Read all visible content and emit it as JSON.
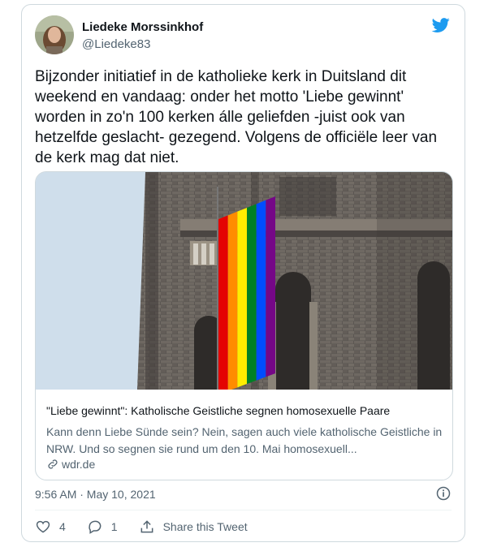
{
  "author": {
    "name": "Liedeke Morssinkhof",
    "handle": "@Liedeke83"
  },
  "tweet": {
    "text": "Bijzonder initiatief in de katholieke kerk in Duitsland dit weekend en vandaag: onder het motto 'Liebe gewinnt' worden in zo'n 100 kerken álle geliefden -juist ook van hetzelfde geslacht- gezegend. Volgens de officiële leer van de kerk mag dat niet.",
    "timestamp": "9:56 AM · May 10, 2021"
  },
  "link_card": {
    "title": "\"Liebe gewinnt\": Katholische Geistliche segnen homosexuelle Paare",
    "description": "Kann denn Liebe Sünde sein? Nein, sagen auch viele katholische Geistliche in NRW. Und so segnen sie rund um den 10. Mai homosexuell...",
    "domain": "wdr.de"
  },
  "actions": {
    "likes": "4",
    "replies": "1",
    "share_label": "Share this Tweet"
  },
  "colors": {
    "brand": "#1d9bf0",
    "secondary_text": "#536471",
    "border": "#cfd9de",
    "rainbow": [
      "#e40303",
      "#ff8c00",
      "#ffed00",
      "#008026",
      "#004dff",
      "#750787"
    ]
  },
  "icons": [
    "twitter-bird-icon",
    "info-icon",
    "like-icon",
    "reply-icon",
    "share-icon",
    "link-icon"
  ]
}
